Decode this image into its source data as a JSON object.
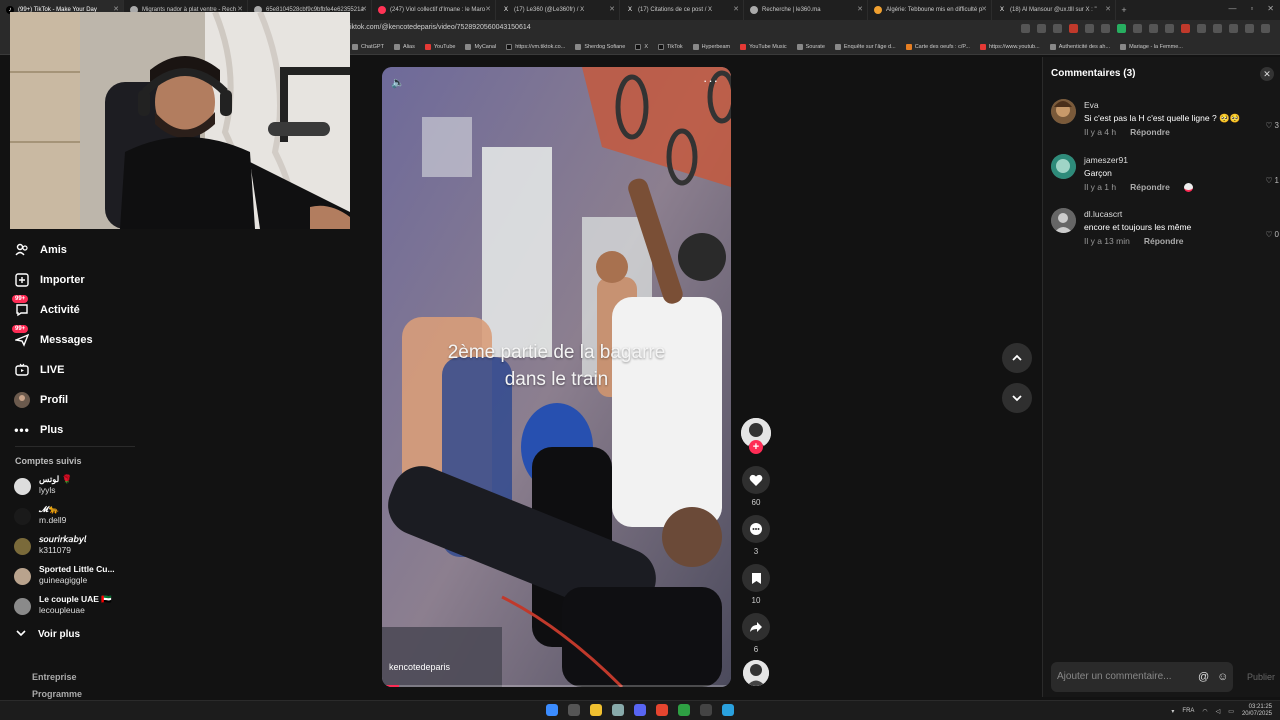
{
  "browser": {
    "tabs": [
      {
        "label": "(99+) TikTok - Make Your Day",
        "active": true,
        "icon_color": "#ffffff"
      },
      {
        "label": "Migrants nador à plat ventre - Rech",
        "icon_color": "#aaaaaa"
      },
      {
        "label": "65e8104528cbf9c9bfbfe4e6235521a",
        "icon_color": "#aaaaaa"
      },
      {
        "label": "(247) Viol collectif d'Imane : le Maro",
        "icon_color": "#ff3355"
      },
      {
        "label": "(17) Le360 (@Le360fr) / X",
        "icon_color": "#ffffff"
      },
      {
        "label": "(17) Citations de ce post / X",
        "icon_color": "#ffffff"
      },
      {
        "label": "Recherche | le360.ma",
        "icon_color": "#aaaaaa"
      },
      {
        "label": "Algérie: Tebboune mis en difficulté p",
        "icon_color": "#f0a030"
      },
      {
        "label": "(18) Al Mansour @ux.tlll sur X : \"",
        "icon_color": "#ffffff"
      }
    ],
    "url": "tiktok.com/@kencotedeparis/video/7528920560043150614",
    "bookmarks": [
      "ChatGPT",
      "Alias",
      "YouTube",
      "MyCanal",
      "https://vm.tiktok.co...",
      "Sherdog Sofiane",
      "X",
      "TikTok",
      "Hyperbeam",
      "YouTube Music",
      "Sourate",
      "Enquête sur l'âge d...",
      "Carte des oeufs : c/P...",
      "https://www.youtub...",
      "Authenticité des ah...",
      "Mariage - la Femme..."
    ]
  },
  "sidebar": {
    "items": [
      {
        "label": "Amis",
        "icon": "friends-icon"
      },
      {
        "label": "Importer",
        "icon": "upload-icon"
      },
      {
        "label": "Activité",
        "icon": "activity-icon",
        "badge": "99+"
      },
      {
        "label": "Messages",
        "icon": "messages-icon",
        "badge": "99+"
      },
      {
        "label": "LIVE",
        "icon": "live-icon"
      },
      {
        "label": "Profil",
        "icon": "profile-icon"
      },
      {
        "label": "Plus",
        "icon": "more-icon"
      }
    ],
    "followed_title": "Comptes suivis",
    "followed": [
      {
        "name": "لوتس 🌹",
        "handle": "lyyls"
      },
      {
        "name": "𝓜🐆",
        "handle": "m.dell9"
      },
      {
        "name": "𝘴𝘰𝘶𝘳𝘪𝘳𝘬𝘢𝘣𝘺𝘭",
        "handle": "k311079"
      },
      {
        "name": "Sported Little Cu...",
        "handle": "guineagiggle"
      },
      {
        "name": "Le couple UAE 🇦🇪",
        "handle": "lecoupleuae"
      }
    ],
    "see_more": "Voir plus",
    "footer": [
      "Entreprise",
      "Programme"
    ]
  },
  "video": {
    "caption_line1": "2ème partie de la bagarre",
    "caption_line2": "dans le train",
    "author_tag": "kencotedeparis",
    "progress": 0.05
  },
  "actions": {
    "likes": "60",
    "comments": "3",
    "saves": "10",
    "shares": "6"
  },
  "comments": {
    "title": "Commentaires (3)",
    "items": [
      {
        "user": "Eva",
        "text": "Si c'est pas la H c'est quelle ligne ? 🥺🥺",
        "time": "Il y a 4 h",
        "reply": "Répondre",
        "likes": "3"
      },
      {
        "user": "jameszer91",
        "text": "Garçon",
        "time": "Il y a 1 h",
        "reply": "Répondre",
        "likes": "1"
      },
      {
        "user": "dl.lucascrt",
        "text": "encore et toujours les même",
        "time": "Il y a 13 min",
        "reply": "Répondre",
        "likes": "0"
      }
    ],
    "input_placeholder": "Ajouter un commentaire...",
    "publish": "Publier"
  },
  "taskbar": {
    "lang": "FRA",
    "time": "03:21:25",
    "date": "20/07/2025"
  },
  "colors": {
    "accent": "#fe2c55",
    "background": "#121212"
  }
}
